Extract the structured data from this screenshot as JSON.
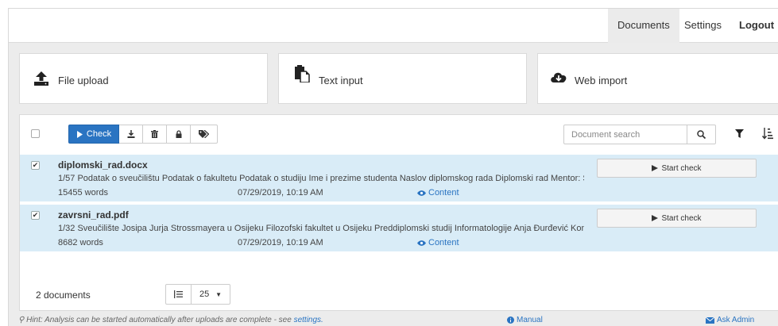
{
  "nav": {
    "documents": "Documents",
    "settings": "Settings",
    "logout": "Logout"
  },
  "cards": {
    "upload": "File upload",
    "text": "Text input",
    "web": "Web import"
  },
  "toolbar": {
    "check_label": "Check"
  },
  "search": {
    "placeholder": "Document search"
  },
  "documents": [
    {
      "name": "diplomski_rad.docx",
      "excerpt": "1/57 Podatak o sveučilištu Podatak o fakultetu Podatak o studiju Ime i prezime studenta Naslov diplomskog rada Diplomski rad Mentor: Su",
      "words": "15455  words",
      "date": "07/29/2019, 10:19 AM",
      "content_link": "Content",
      "start_label": "Start check",
      "checked": true
    },
    {
      "name": "zavrsni_rad.pdf",
      "excerpt": "1/32 Sveučilište Josipa Jurja Strossmayera u Osijeku Filozofski fakultet u Osijeku Preddiplomski studij Informatologije Anja Đurđević Komp",
      "words": "8682  words",
      "date": "07/29/2019, 10:19 AM",
      "content_link": "Content",
      "start_label": "Start check",
      "checked": true
    }
  ],
  "footer_panel": {
    "count": "2 documents",
    "page_size": "25"
  },
  "footer": {
    "hint_text": "Hint: Analysis can be started automatically after uploads are complete - see ",
    "hint_link": "settings.",
    "manual": "Manual",
    "ask_admin": "Ask Admin"
  },
  "colors": {
    "accent": "#2a74c2",
    "row_selected": "#d9ecf7",
    "background": "#ececec"
  }
}
